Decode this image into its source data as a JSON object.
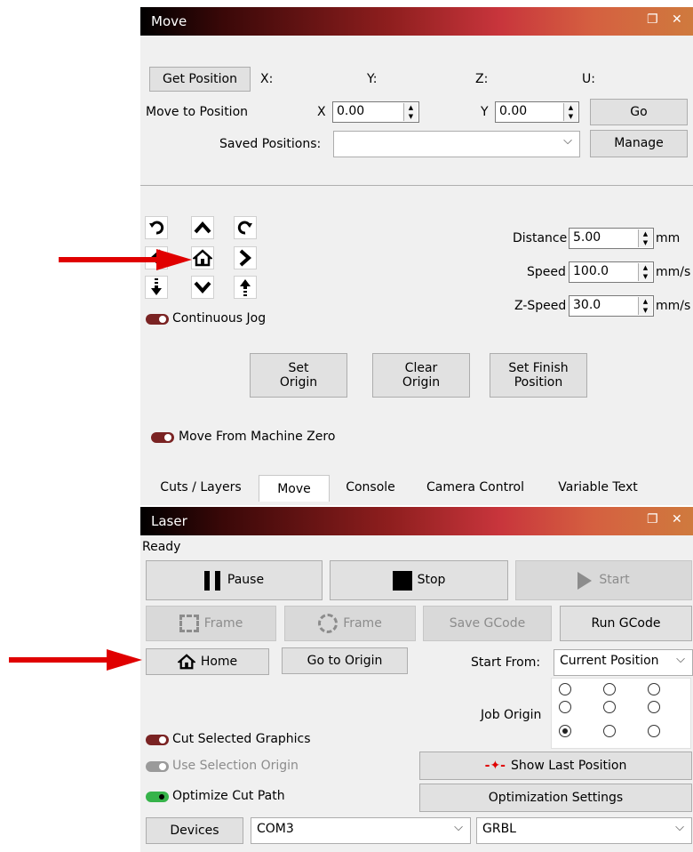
{
  "move_panel": {
    "title": "Move",
    "get_position_label": "Get Position",
    "x_label": "X:",
    "y_label": "Y:",
    "z_label": "Z:",
    "u_label": "U:",
    "move_to_position_label": "Move to Position",
    "x_field_label": "X",
    "x_value": "0.00",
    "y_field_label": "Y",
    "y_value": "0.00",
    "go_label": "Go",
    "saved_positions_label": "Saved Positions:",
    "saved_positions_value": "",
    "manage_label": "Manage",
    "distance_label": "Distance",
    "distance_value": "5.00",
    "distance_unit": "mm",
    "speed_label": "Speed",
    "speed_value": "100.0",
    "speed_unit": "mm/s",
    "zspeed_label": "Z-Speed",
    "zspeed_value": "30.0",
    "zspeed_unit": "mm/s",
    "continuous_jog_label": "Continuous Jog",
    "set_origin_label": "Set\nOrigin",
    "clear_origin_label": "Clear\nOrigin",
    "set_finish_label": "Set Finish\nPosition",
    "move_from_machine_zero_label": "Move From Machine Zero",
    "jog_icons": [
      "rotate-ccw-icon",
      "arrow-up-icon",
      "rotate-cw-icon",
      "arrow-left-icon",
      "home-icon",
      "arrow-right-icon",
      "z-down-icon",
      "arrow-down-icon",
      "z-up-icon"
    ]
  },
  "tabs": [
    "Cuts / Layers",
    "Move",
    "Console",
    "Camera Control",
    "Variable Text"
  ],
  "active_tab": "Move",
  "laser_panel": {
    "title": "Laser",
    "status": "Ready",
    "pause_label": "Pause",
    "stop_label": "Stop",
    "start_label": "Start",
    "frame1_label": "Frame",
    "frame2_label": "Frame",
    "save_gcode_label": "Save GCode",
    "run_gcode_label": "Run GCode",
    "home_label": "Home",
    "go_to_origin_label": "Go to Origin",
    "start_from_label": "Start From:",
    "start_from_value": "Current Position",
    "job_origin_label": "Job Origin",
    "job_origin_selected": 6,
    "cut_selected_graphics_label": "Cut Selected Graphics",
    "use_selection_origin_label": "Use Selection Origin",
    "optimize_cut_path_label": "Optimize Cut Path",
    "show_last_position_label": "Show Last Position",
    "optimization_settings_label": "Optimization Settings",
    "devices_label": "Devices",
    "port_value": "COM3",
    "controller_value": "GRBL"
  },
  "colors": {
    "annotation_arrow": "#e00000",
    "toggle_off": "#7a2323",
    "toggle_on": "#36b34a"
  }
}
